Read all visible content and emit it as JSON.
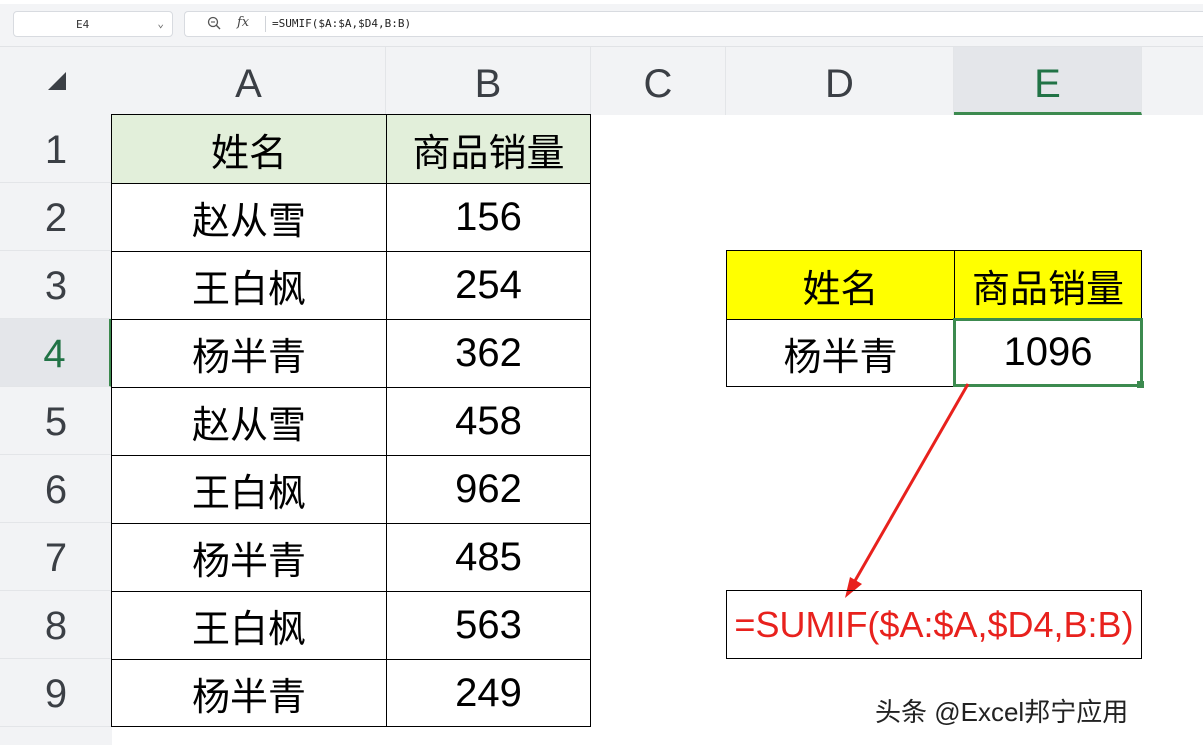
{
  "formula_bar": {
    "cell_ref": "E4",
    "dropdown_icon": "chevron-down-icon",
    "zoom_icon": "zoom-icon",
    "fx_label": "fx",
    "formula": "=SUMIF($A:$A,$D4,B:B)"
  },
  "sheet": {
    "columns": [
      "A",
      "B",
      "C",
      "D",
      "E"
    ],
    "active_column": "E",
    "rows": [
      "1",
      "2",
      "3",
      "4",
      "5",
      "6",
      "7",
      "8",
      "9"
    ],
    "active_row": "4",
    "table": {
      "header": [
        "姓名",
        "商品销量"
      ],
      "rows": [
        [
          "赵从雪",
          "156"
        ],
        [
          "王白枫",
          "254"
        ],
        [
          "杨半青",
          "362"
        ],
        [
          "赵从雪",
          "458"
        ],
        [
          "王白枫",
          "962"
        ],
        [
          "杨半青",
          "485"
        ],
        [
          "王白枫",
          "563"
        ],
        [
          "杨半青",
          "249"
        ]
      ]
    },
    "lookup": {
      "header": [
        "姓名",
        "商品销量"
      ],
      "name": "杨半青",
      "result": "1096"
    },
    "formula_note": "=SUMIF($A:$A,$D4,B:B)"
  },
  "colors": {
    "table_header_bg": "#e2efda",
    "lookup_header_bg": "#ffff00",
    "selection": "#3c8a4f",
    "annotation": "#e8211d"
  },
  "watermark": "头条 @Excel邦宁应用"
}
